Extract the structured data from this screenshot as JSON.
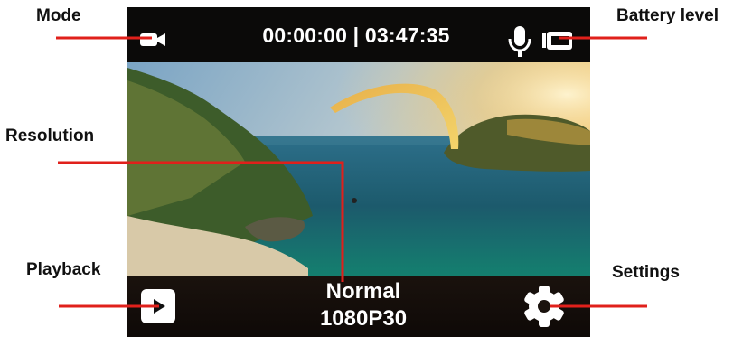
{
  "callouts": {
    "mode": "Mode",
    "battery": "Battery level",
    "resolution": "Resolution",
    "playback": "Playback",
    "settings": "Settings"
  },
  "screen": {
    "elapsed": "00:00:00",
    "separator": "|",
    "remaining": "03:47:35",
    "mode_icon": "video-camera-icon",
    "mic_icon": "microphone-icon",
    "battery_icon": "battery-icon",
    "playback_icon": "play-icon",
    "settings_icon": "gear-icon",
    "quality_mode": "Normal",
    "resolution": "1080P30"
  },
  "colors": {
    "leader_line": "#e0201b",
    "overlay_text": "#ffffff",
    "bar_background": "#0b0a09"
  }
}
